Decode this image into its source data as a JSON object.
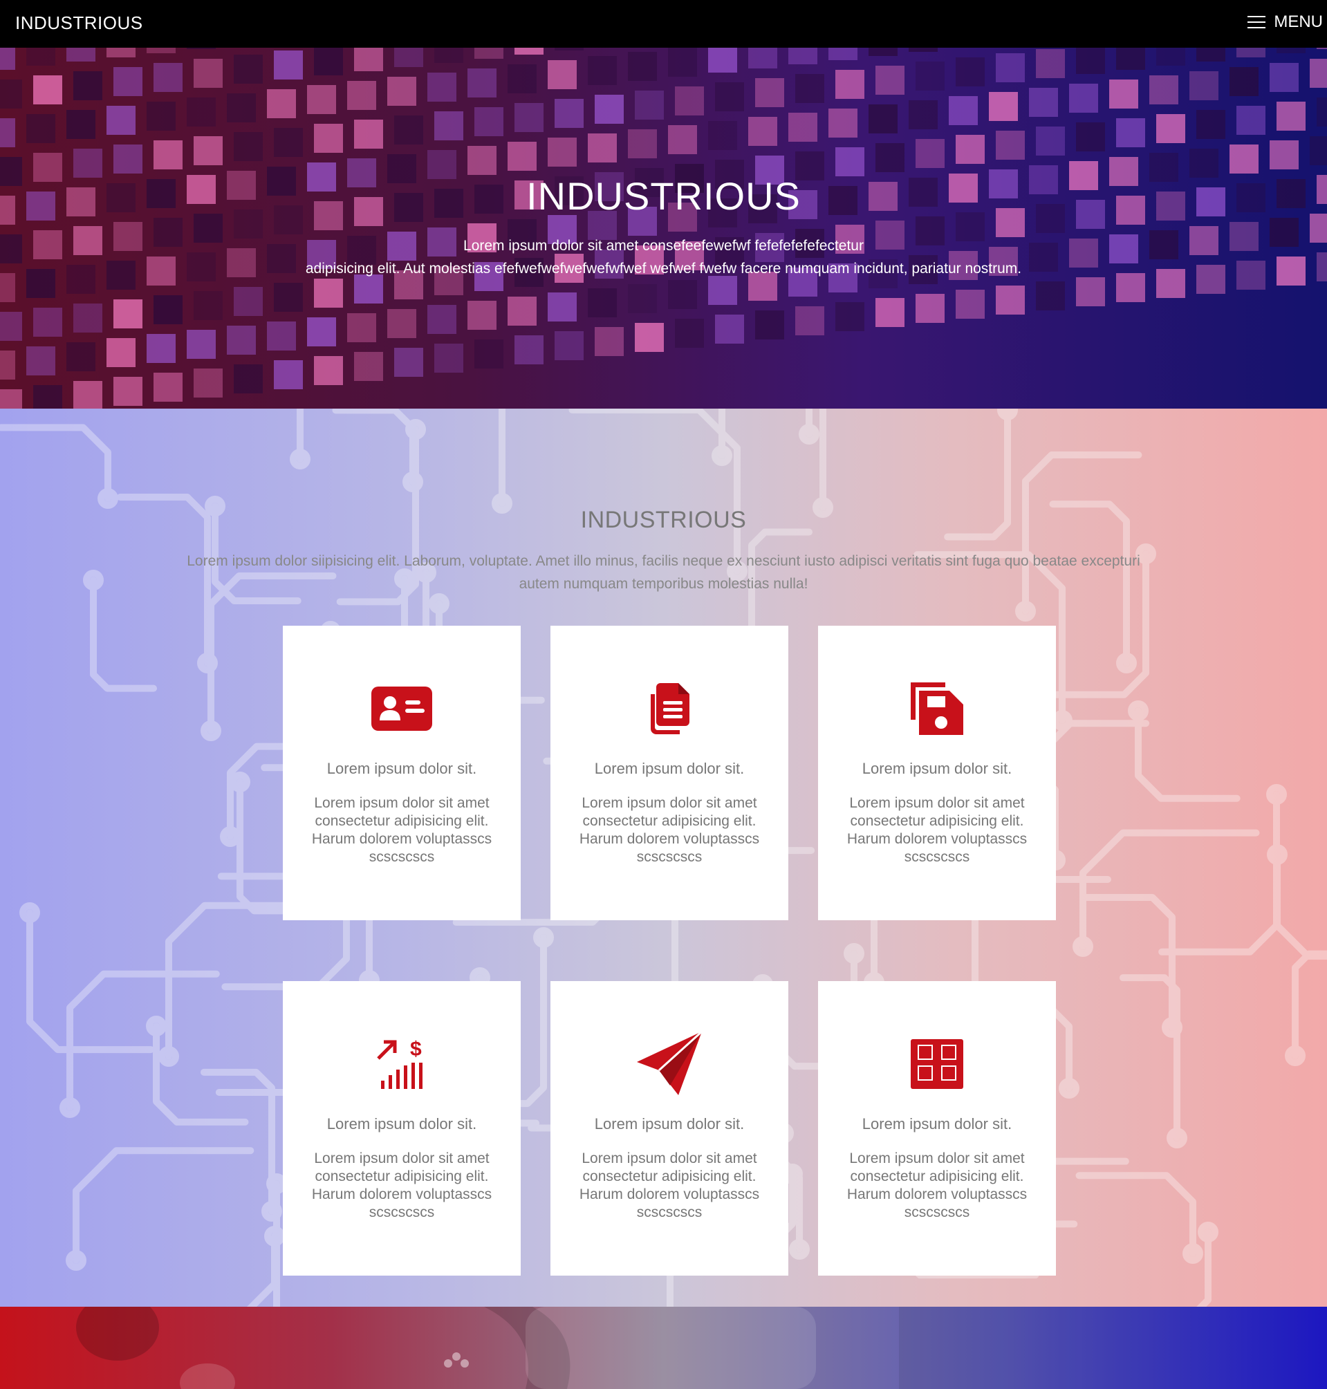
{
  "nav": {
    "brand": "INDUSTRIOUS",
    "menu_label": "MENU"
  },
  "hero": {
    "title": "INDUSTRIOUS",
    "line1": "Lorem ipsum dolor sit amet consefeefewefwf fefefefefefectetur",
    "line2": "adipisicing elit. Aut molestias efefwefwefwefwefwfwef wefwef fwefw facere numquam incidunt, pariatur nostrum."
  },
  "features": {
    "title": "INDUSTRIOUS",
    "line1": "Lorem ipsum dolor siipisicing elit. Laborum, voluptate. Amet illo minus, facilis neque ex nesciunt iusto adipisci veritatis sint fuga quo beatae excepturi",
    "line2": "autem numquam temporibus molestias nulla!",
    "accent_color": "#c8111a",
    "cards": [
      {
        "icon": "id-card-icon",
        "title": "Lorem ipsum dolor sit.",
        "text": "Lorem ipsum dolor sit amet consectetur adipisicing elit. Harum dolorem voluptasscs scscscscs"
      },
      {
        "icon": "documents-icon",
        "title": "Lorem ipsum dolor sit.",
        "text": "Lorem ipsum dolor sit amet consectetur adipisicing elit. Harum dolorem voluptasscs scscscscs"
      },
      {
        "icon": "floppy-disk-icon",
        "title": "Lorem ipsum dolor sit.",
        "text": "Lorem ipsum dolor sit amet consectetur adipisicing elit. Harum dolorem voluptasscs scscscscs"
      },
      {
        "icon": "growth-chart-dollar-icon",
        "title": "Lorem ipsum dolor sit.",
        "text": "Lorem ipsum dolor sit amet consectetur adipisicing elit. Harum dolorem voluptasscs scscscscs"
      },
      {
        "icon": "paper-plane-icon",
        "title": "Lorem ipsum dolor sit.",
        "text": "Lorem ipsum dolor sit amet consectetur adipisicing elit. Harum dolorem voluptasscs scscscscs"
      },
      {
        "icon": "grid-blocks-icon",
        "title": "Lorem ipsum dolor sit.",
        "text": "Lorem ipsum dolor sit amet consectetur adipisicing elit. Harum dolorem voluptasscs scscscscs"
      }
    ]
  }
}
